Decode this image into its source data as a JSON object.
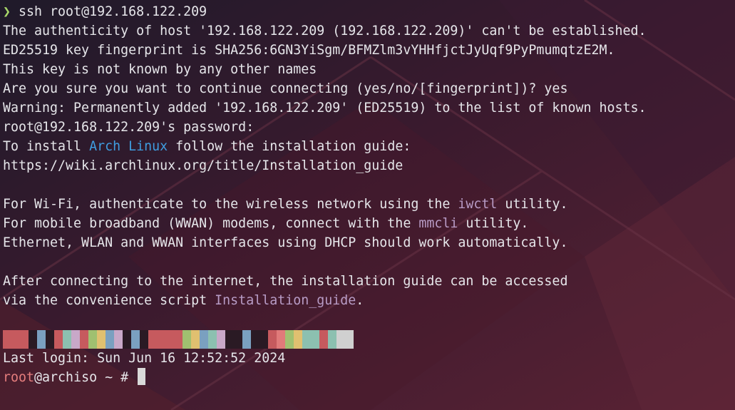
{
  "terminal": {
    "prompt_symbol": "❯",
    "command": " ssh root@192.168.122.209",
    "lines": {
      "auth": "The authenticity of host '192.168.122.209 (192.168.122.209)' can't be established.",
      "fingerprint": "ED25519 key fingerprint is SHA256:6GN3YiSgm/BFMZlm3vYHHfjctJyUqf9PyPmumqtzE2M.",
      "not_known": "This key is not known by any other names",
      "continue_q": "Are you sure you want to continue connecting (yes/no/[fingerprint])? yes",
      "warning": "Warning: Permanently added '192.168.122.209' (ED25519) to the list of known hosts.",
      "password": "root@192.168.122.209's password:",
      "install_pre": "To install ",
      "install_arch": "Arch Linux",
      "install_post": " follow the installation guide:",
      "wiki_url": "https://wiki.archlinux.org/title/Installation_guide",
      "wifi_pre": "For Wi-Fi, authenticate to the wireless network using the ",
      "wifi_tool": "iwctl",
      "wifi_post": " utility.",
      "wwan_pre": "For mobile broadband (WWAN) modems, connect with the ",
      "wwan_tool": "mmcli",
      "wwan_post": " utility.",
      "ethernet": "Ethernet, WLAN and WWAN interfaces using DHCP should work automatically.",
      "after1": "After connecting to the internet, the installation guide can be accessed",
      "after2_pre": "via the convenience script ",
      "after2_script": "Installation_guide",
      "after2_post": ".",
      "last_login": "Last login: Sun Jun 16 12:52:52 2024",
      "prompt_user": "root",
      "prompt_rest": "@archiso ~ # "
    },
    "swatches": [
      "#c65a5e",
      "#c65a5e",
      "#c65a5e",
      "#2a1a24",
      "#7aa0c0",
      "#2a1a24",
      "#c65a5e",
      "#8cc0b0",
      "#c8a8c8",
      "#c65a5e",
      "#a0c070",
      "#e0c070",
      "#7aa0c0",
      "#c8a8c8",
      "#2a1a24",
      "#7aa0c0",
      "#2a1a24",
      "#c65a5e",
      "#c65a5e",
      "#c65a5e",
      "#c65a5e",
      "#a0c070",
      "#e0c070",
      "#7aa0c0",
      "#8cc0b0",
      "#c8a8c8",
      "#2a1a24",
      "#2a1a24",
      "#7aa0c0",
      "#2a1a24",
      "#2a1a24",
      "#c65a5e",
      "#e07a7a",
      "#a0c070",
      "#e0c070",
      "#8cc0b0",
      "#8cc0b0",
      "#c65a5e",
      "#8cc0b0",
      "#d0d0d0",
      "#d0d0d0"
    ]
  }
}
